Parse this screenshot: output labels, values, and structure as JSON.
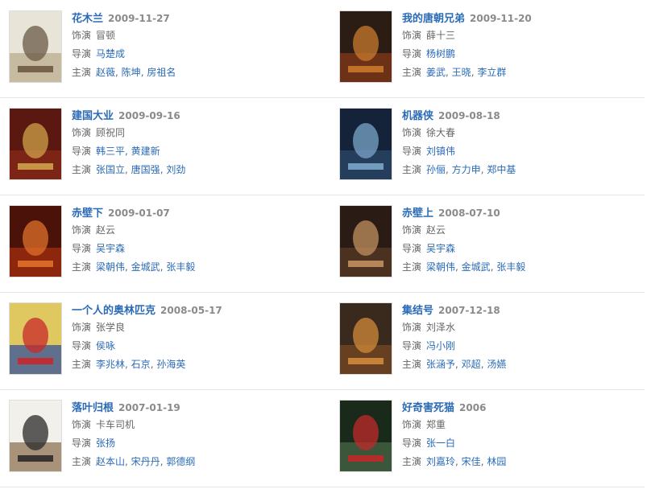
{
  "labels": {
    "role": "饰演",
    "director": "导演",
    "cast": "主演"
  },
  "movies": [
    {
      "title": "花木兰",
      "date": "2009-11-27",
      "role": "冒顿",
      "director": "马楚成",
      "cast": [
        "赵薇",
        "陈坤",
        "房祖名"
      ],
      "poster": {
        "bg": "#e8e4d8",
        "fg": "#6b5a45",
        "accent": "#b8a88a"
      }
    },
    {
      "title": "我的唐朝兄弟",
      "date": "2009-11-20",
      "role": "薛十三",
      "director": "杨树鹏",
      "cast": [
        "姜武",
        "王晓",
        "李立群"
      ],
      "poster": {
        "bg": "#2b1d14",
        "fg": "#c8792c",
        "accent": "#8a3a1a"
      }
    },
    {
      "title": "建国大业",
      "date": "2009-09-16",
      "role": "顾祝同",
      "director": "韩三平, 黄建新",
      "cast": [
        "张国立",
        "唐国强",
        "刘劲"
      ],
      "poster": {
        "bg": "#5a1810",
        "fg": "#d0a24a",
        "accent": "#8a2a1a"
      }
    },
    {
      "title": "机器侠",
      "date": "2009-08-18",
      "role": "徐大春",
      "director": "刘镇伟",
      "cast": [
        "孙俪",
        "方力申",
        "郑中基"
      ],
      "poster": {
        "bg": "#14233a",
        "fg": "#7aa6c8",
        "accent": "#2b4a6a"
      }
    },
    {
      "title": "赤壁下",
      "date": "2009-01-07",
      "role": "赵云",
      "director": "吴宇森",
      "cast": [
        "梁朝伟",
        "金城武",
        "张丰毅"
      ],
      "poster": {
        "bg": "#4a1208",
        "fg": "#e0702a",
        "accent": "#a83010"
      }
    },
    {
      "title": "赤壁上",
      "date": "2008-07-10",
      "role": "赵云",
      "director": "吴宇森",
      "cast": [
        "梁朝伟",
        "金城武",
        "张丰毅"
      ],
      "poster": {
        "bg": "#2a1c14",
        "fg": "#c09060",
        "accent": "#5a3a24"
      }
    },
    {
      "title": "一个人的奥林匹克",
      "date": "2008-05-17",
      "role": "张学良",
      "director": "侯咏",
      "cast": [
        "李兆林",
        "石京",
        "孙海英"
      ],
      "poster": {
        "bg": "#e0c860",
        "fg": "#c8282a",
        "accent": "#2a4aa0"
      }
    },
    {
      "title": "集结号",
      "date": "2007-12-18",
      "role": "刘泽水",
      "director": "冯小刚",
      "cast": [
        "张涵予",
        "邓超",
        "汤嬿"
      ],
      "poster": {
        "bg": "#3a2a1e",
        "fg": "#d08a3a",
        "accent": "#7a4a24"
      }
    },
    {
      "title": "落叶归根",
      "date": "2007-01-19",
      "role": "卡车司机",
      "director": "张扬",
      "cast": [
        "赵本山",
        "宋丹丹",
        "郭德纲"
      ],
      "poster": {
        "bg": "#f2f0ea",
        "fg": "#2a2a2a",
        "accent": "#8a6a4a"
      }
    },
    {
      "title": "好奇害死猫",
      "date": "2006",
      "role": "郑重",
      "director": "张一白",
      "cast": [
        "刘嘉玲",
        "宋佳",
        "林园"
      ],
      "poster": {
        "bg": "#1a2a1a",
        "fg": "#c02a2a",
        "accent": "#4a6a4a"
      }
    }
  ]
}
